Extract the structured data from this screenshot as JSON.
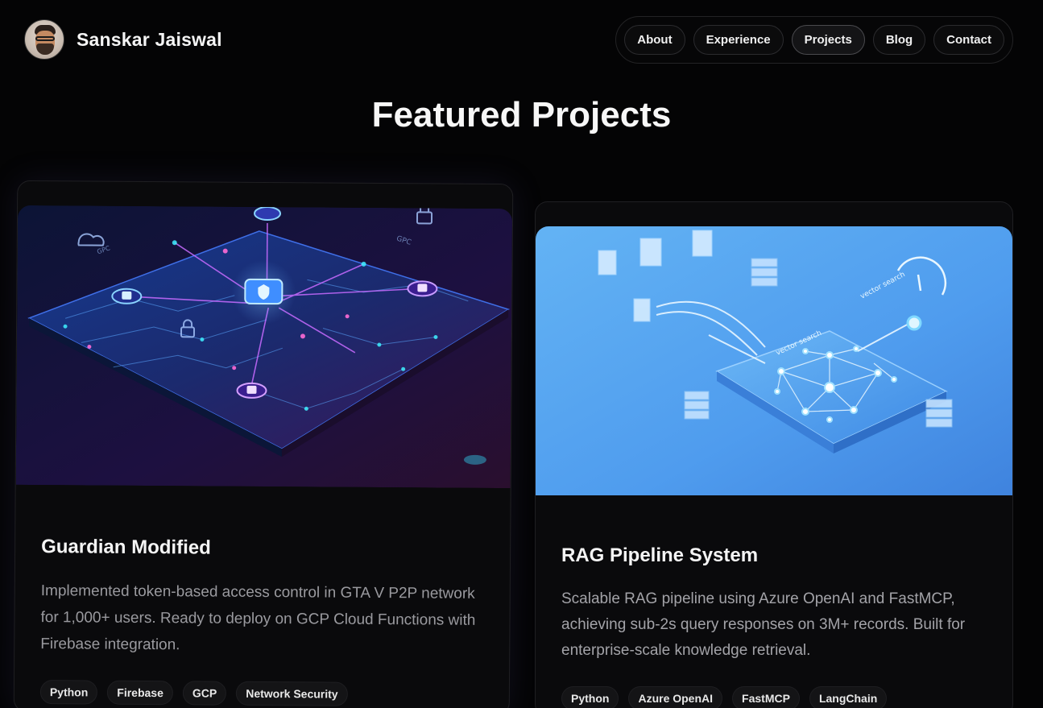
{
  "header": {
    "name": "Sanskar Jaiswal",
    "nav": [
      {
        "label": "About",
        "active": false
      },
      {
        "label": "Experience",
        "active": false
      },
      {
        "label": "Projects",
        "active": true
      },
      {
        "label": "Blog",
        "active": false
      },
      {
        "label": "Contact",
        "active": false
      }
    ]
  },
  "section": {
    "title": "Featured Projects"
  },
  "projects": [
    {
      "title": "Guardian Modified",
      "description": "Implemented token-based access control in GTA V P2P network for 1,000+ users. Ready to deploy on GCP Cloud Functions with Firebase integration.",
      "image_labels": [
        "GPC",
        "GPC"
      ],
      "tags": [
        "Python",
        "Firebase",
        "GCP",
        "Network Security"
      ]
    },
    {
      "title": "RAG Pipeline System",
      "description": "Scalable RAG pipeline using Azure OpenAI and FastMCP, achieving sub-2s query responses on 3M+ records. Built for enterprise-scale knowledge retrieval.",
      "image_labels": [
        "vector search",
        "vector search"
      ],
      "tags": [
        "Python",
        "Azure OpenAI",
        "FastMCP",
        "LangChain"
      ]
    }
  ],
  "colors": {
    "background": "#040405",
    "accent_purple": "#8a5cff",
    "accent_cyan": "#48c6ff",
    "accent_blue": "#4e9eee"
  }
}
